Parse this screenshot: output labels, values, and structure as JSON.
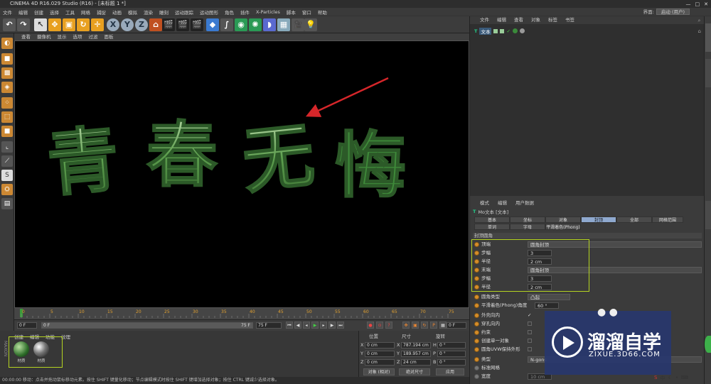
{
  "title": "CINEMA 4D R16.029 Studio (R16) - [未标题 1 *]",
  "menu": [
    "文件",
    "编辑",
    "创建",
    "选择",
    "工具",
    "网格",
    "捕捉",
    "动画",
    "模拟",
    "渲染",
    "雕刻",
    "运动跟踪",
    "运动图形",
    "角色",
    "插件",
    "X-Particles",
    "脚本",
    "窗口",
    "帮助"
  ],
  "layout": {
    "label": "界面:",
    "value": "启动 (用户)"
  },
  "viewport_menu": [
    "查看",
    "摄像机",
    "显示",
    "选项",
    "过滤",
    "面板"
  ],
  "viewport_text": [
    "青",
    "春",
    "无",
    "悔"
  ],
  "timeline": {
    "ticks": [
      "0",
      "5",
      "10",
      "15",
      "20",
      "25",
      "30",
      "35",
      "40",
      "45",
      "50",
      "55",
      "60",
      "65",
      "70",
      "75"
    ],
    "frame_current": "0 F",
    "frame_start": "0 F",
    "frame_end": "75 F",
    "frame_end2": "75 F",
    "frame_right": "0 F"
  },
  "material_panel": {
    "menu": [
      "创建",
      "编辑",
      "功能",
      "纹理"
    ],
    "materials": [
      {
        "name": "材质"
      },
      {
        "name": "材质"
      }
    ]
  },
  "coords": {
    "headers": {
      "pos": "位置",
      "size": "尺寸",
      "rot": "旋转"
    },
    "rows": [
      {
        "axis": "X",
        "pos": "0 cm",
        "size_axis": "X",
        "size": "787.194 cm",
        "rot_axis": "H",
        "rot": "0 °"
      },
      {
        "axis": "Y",
        "pos": "0 cm",
        "size_axis": "Y",
        "size": "189.957 cm",
        "rot_axis": "P",
        "rot": "0 °"
      },
      {
        "axis": "Z",
        "pos": "0 cm",
        "size_axis": "Z",
        "size": "24 cm",
        "rot_axis": "B",
        "rot": "0 °"
      }
    ],
    "mode1": "对象 (相对)",
    "mode2": "绝对尺寸",
    "apply": "应用"
  },
  "status": "00:00:00    移动：点击并拖动鼠标移动元素。按住 SHIFT 键量化移动；节点编辑模式时按住 SHIFT 键增加选择对象；按住 CTRL 键减少选择对象。",
  "object_manager": {
    "menu": [
      "文件",
      "编辑",
      "查看",
      "对象",
      "标签",
      "书签"
    ],
    "items": [
      {
        "name": "文本"
      }
    ]
  },
  "attributes": {
    "menu": [
      "模式",
      "编辑",
      "用户数据"
    ],
    "object_title": "Mo文本 [文本]",
    "tabs_row1": [
      "基本",
      "坐标",
      "对象",
      "封顶",
      "全部",
      "网格范围"
    ],
    "tabs_row2": [
      "单词",
      "字母",
      "平滑着色(Phong)"
    ],
    "active_tab": "封顶",
    "section": "封顶圆角",
    "fields": [
      {
        "label": "顶端",
        "type": "dropdown",
        "value": "圆角封顶"
      },
      {
        "label": "步幅",
        "type": "num",
        "value": "3"
      },
      {
        "label": "半径",
        "type": "num",
        "value": "2 cm"
      },
      {
        "label": "末端",
        "type": "dropdown",
        "value": "圆角封顶"
      },
      {
        "label": "步幅",
        "type": "num",
        "value": "3"
      },
      {
        "label": "半径",
        "type": "num",
        "value": "2 cm"
      },
      {
        "label": "圆角类型",
        "type": "dropdown_short",
        "value": "凸起"
      },
      {
        "label": "平滑着色(Phong)角度",
        "type": "num",
        "value": "60 °"
      },
      {
        "label": "外壳向内",
        "type": "check",
        "value": "✓"
      },
      {
        "label": "穿孔向内",
        "type": "check",
        "value": ""
      },
      {
        "label": "约束",
        "type": "check",
        "value": ""
      },
      {
        "label": "创建单一对象",
        "type": "check",
        "value": ""
      },
      {
        "label": "圆角UVW保持外形",
        "type": "check",
        "value": ""
      }
    ],
    "type_label": "类型",
    "type_value": "N-gons",
    "std_grid": "标准网格",
    "width_label": "宽度",
    "width_value": "10 cm"
  },
  "watermark": {
    "title": "溜溜自学",
    "url": "ZIXUE.3D66.COM"
  },
  "colors": {
    "highlight": "#b5d421",
    "active_tab": "#8fa9cf",
    "text_green": "#5d9e4e",
    "arrow": "#d6262a"
  }
}
